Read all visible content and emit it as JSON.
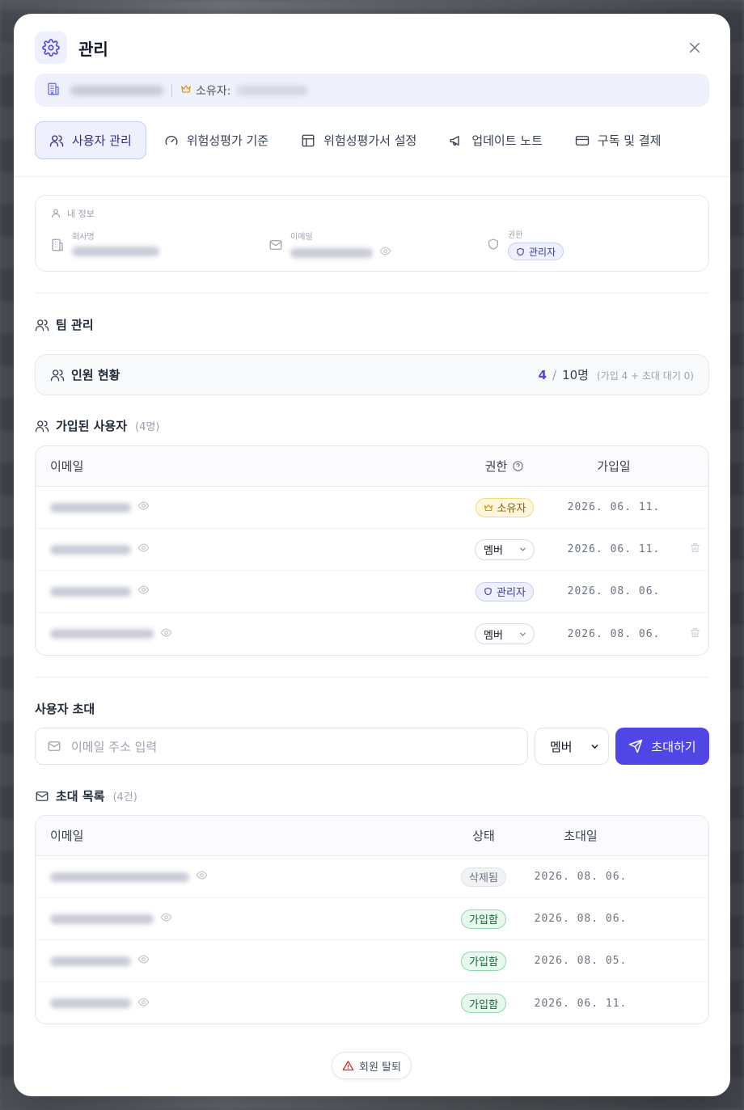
{
  "modal": {
    "title": "관리",
    "owner_label": "소유자:"
  },
  "tabs": [
    {
      "label": "사용자 관리",
      "icon": "users-icon",
      "active": true
    },
    {
      "label": "위험성평가 기준",
      "icon": "gauge-icon",
      "active": false
    },
    {
      "label": "위험성평가서 설정",
      "icon": "table-icon",
      "active": false
    },
    {
      "label": "업데이트 노트",
      "icon": "megaphone-icon",
      "active": false
    },
    {
      "label": "구독 및 결제",
      "icon": "credit-card-icon",
      "active": false
    }
  ],
  "my_info": {
    "heading": "내 정보",
    "company_label": "회사명",
    "email_label": "이메일",
    "role_label": "권한",
    "role_value": "관리자"
  },
  "team": {
    "heading": "팀 관리",
    "headcount_label": "인원 현황",
    "current": "4",
    "slash": "/",
    "capacity": "10명",
    "detail": "(가입 4 + 초대 대기 0)"
  },
  "members": {
    "heading": "가입된 사용자",
    "count": "(4명)",
    "columns": {
      "email": "이메일",
      "role": "권한",
      "joined": "가입일"
    },
    "rows": [
      {
        "role_type": "owner",
        "role": "소유자",
        "date": "2026. 06. 11.",
        "deletable": false
      },
      {
        "role_type": "select",
        "role": "멤버",
        "date": "2026. 06. 11.",
        "deletable": true
      },
      {
        "role_type": "admin",
        "role": "관리자",
        "date": "2026. 08. 06.",
        "deletable": false
      },
      {
        "role_type": "select",
        "role": "멤버",
        "date": "2026. 08. 06.",
        "deletable": true
      }
    ]
  },
  "invite": {
    "heading": "사용자 초대",
    "placeholder": "이메일 주소 입력",
    "role_value": "멤버",
    "button_label": "초대하기"
  },
  "invites": {
    "heading": "초대 목록",
    "count": "(4건)",
    "columns": {
      "email": "이메일",
      "status": "상태",
      "date": "초대일"
    },
    "rows": [
      {
        "status_type": "deleted",
        "status": "삭제됨",
        "date": "2026. 08. 06."
      },
      {
        "status_type": "joined",
        "status": "가입함",
        "date": "2026. 08. 06."
      },
      {
        "status_type": "joined",
        "status": "가입함",
        "date": "2026. 08. 05."
      },
      {
        "status_type": "joined",
        "status": "가입함",
        "date": "2026. 06. 11."
      }
    ]
  },
  "footer": {
    "withdraw_label": "회원 탈퇴"
  },
  "colors": {
    "accent": "#4f46e5",
    "joined_green": "#166534",
    "owner_gold": "#d99a00"
  }
}
